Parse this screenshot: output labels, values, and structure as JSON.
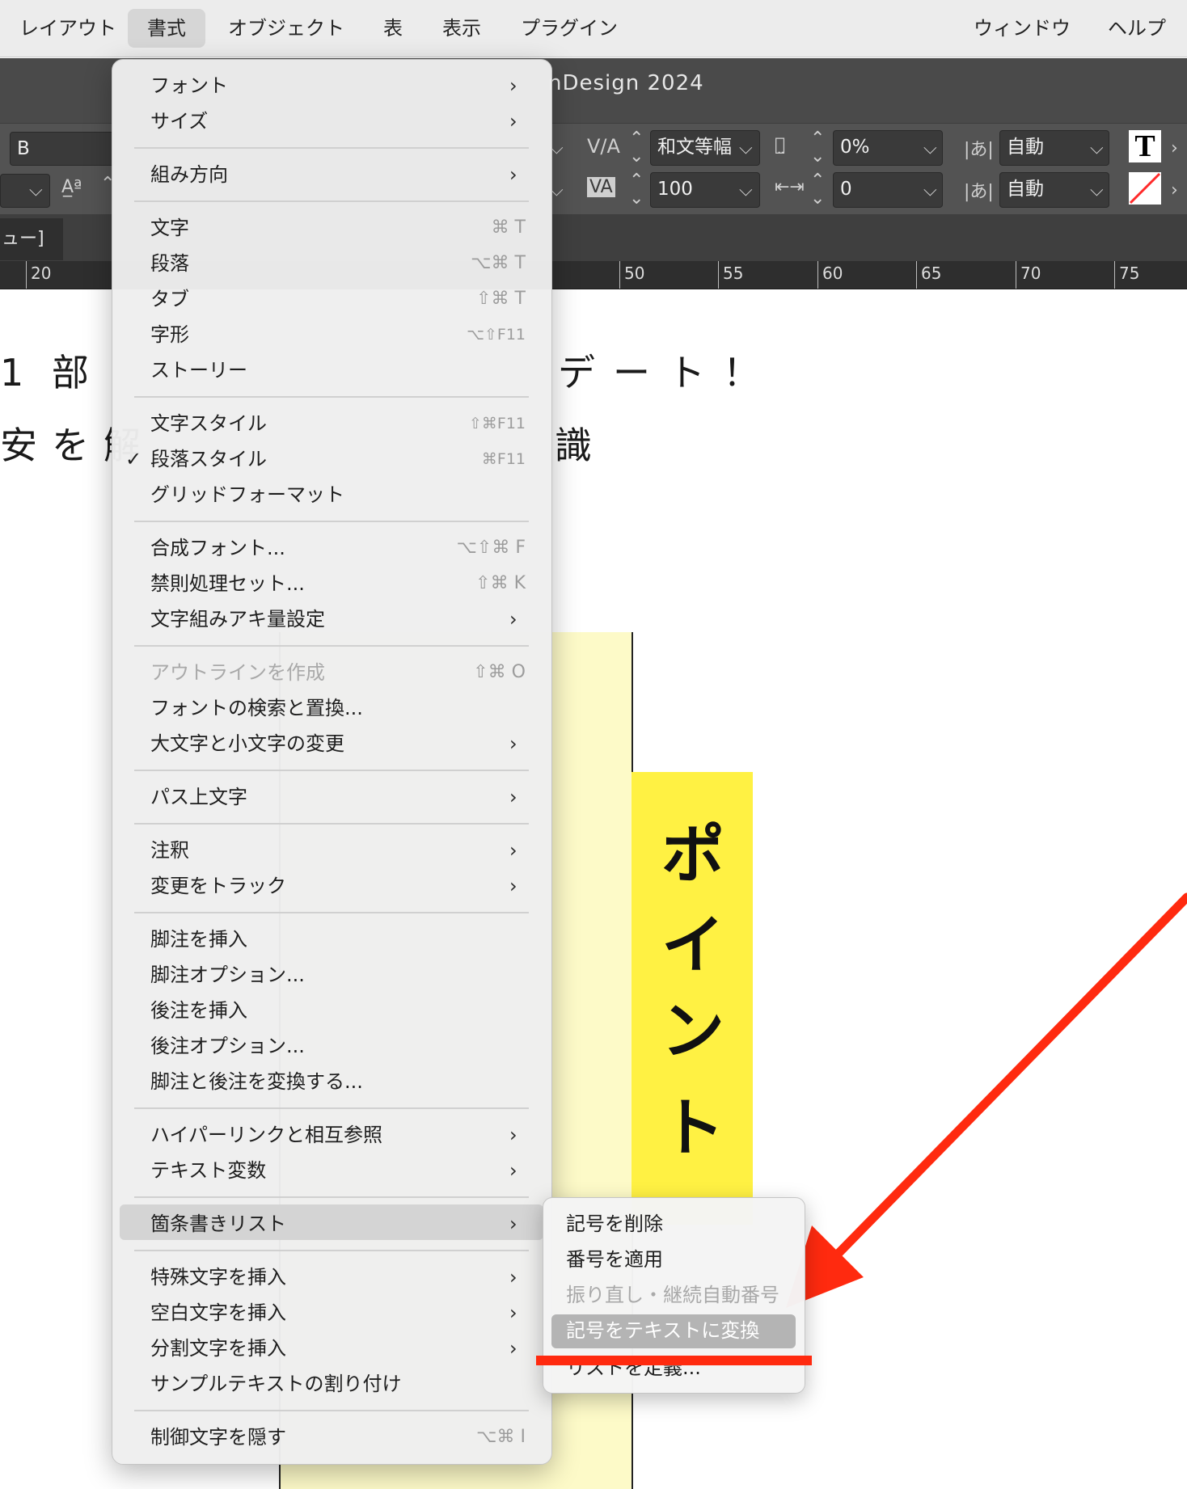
{
  "menubar": {
    "items": [
      "レイアウト",
      "書式",
      "オブジェクト",
      "表",
      "表示",
      "プラグイン",
      "ウィンドウ",
      "ヘルプ"
    ]
  },
  "window": {
    "title_partial": "nDesign 2024"
  },
  "control_bar": {
    "font_style": "B",
    "kerning_value": "和文等幅",
    "tracking_value": "0%",
    "vertical_scale_value": "100",
    "baseline_value": "0",
    "aki_before": "自動",
    "aki_after": "自動"
  },
  "doc_tab": {
    "label": "ュー]"
  },
  "ruler": {
    "labels": [
      "20",
      "50",
      "55",
      "60",
      "65",
      "70",
      "75"
    ]
  },
  "document": {
    "line1_left": "1 部",
    "line1_right": "デート！",
    "line2_left": "安を解",
    "line2_right": "識",
    "point_label": [
      "ポ",
      "イ",
      "ン",
      "ト"
    ]
  },
  "format_menu": {
    "items": [
      {
        "label": "フォント",
        "shortcut": "",
        "submenu": true,
        "disabled": false
      },
      {
        "label": "サイズ",
        "shortcut": "",
        "submenu": true,
        "disabled": false
      },
      {
        "label": "組み方向",
        "shortcut": "",
        "submenu": true,
        "disabled": false
      },
      {
        "label": "文字",
        "shortcut": "⌘ T",
        "submenu": false,
        "disabled": false
      },
      {
        "label": "段落",
        "shortcut": "⌥⌘ T",
        "submenu": false,
        "disabled": false
      },
      {
        "label": "タブ",
        "shortcut": "⇧⌘ T",
        "submenu": false,
        "disabled": false
      },
      {
        "label": "字形",
        "shortcut": "⌥⇧F11",
        "submenu": false,
        "disabled": false
      },
      {
        "label": "ストーリー",
        "shortcut": "",
        "submenu": false,
        "disabled": false
      },
      {
        "label": "文字スタイル",
        "shortcut": "⇧⌘F11",
        "submenu": false,
        "disabled": false
      },
      {
        "label": "段落スタイル",
        "shortcut": "⌘F11",
        "submenu": false,
        "disabled": false,
        "checked": true
      },
      {
        "label": "グリッドフォーマット",
        "shortcut": "",
        "submenu": false,
        "disabled": false
      },
      {
        "label": "合成フォント...",
        "shortcut": "⌥⇧⌘ F",
        "submenu": false,
        "disabled": false
      },
      {
        "label": "禁則処理セット...",
        "shortcut": "⇧⌘ K",
        "submenu": false,
        "disabled": false
      },
      {
        "label": "文字組みアキ量設定",
        "shortcut": "",
        "submenu": true,
        "disabled": false
      },
      {
        "label": "アウトラインを作成",
        "shortcut": "⇧⌘ O",
        "submenu": false,
        "disabled": true
      },
      {
        "label": "フォントの検索と置換...",
        "shortcut": "",
        "submenu": false,
        "disabled": false
      },
      {
        "label": "大文字と小文字の変更",
        "shortcut": "",
        "submenu": true,
        "disabled": false
      },
      {
        "label": "パス上文字",
        "shortcut": "",
        "submenu": true,
        "disabled": false
      },
      {
        "label": "注釈",
        "shortcut": "",
        "submenu": true,
        "disabled": false
      },
      {
        "label": "変更をトラック",
        "shortcut": "",
        "submenu": true,
        "disabled": false
      },
      {
        "label": "脚注を挿入",
        "shortcut": "",
        "submenu": false,
        "disabled": false
      },
      {
        "label": "脚注オプション...",
        "shortcut": "",
        "submenu": false,
        "disabled": false
      },
      {
        "label": "後注を挿入",
        "shortcut": "",
        "submenu": false,
        "disabled": false
      },
      {
        "label": "後注オプション...",
        "shortcut": "",
        "submenu": false,
        "disabled": false
      },
      {
        "label": "脚注と後注を変換する...",
        "shortcut": "",
        "submenu": false,
        "disabled": false
      },
      {
        "label": "ハイパーリンクと相互参照",
        "shortcut": "",
        "submenu": true,
        "disabled": false
      },
      {
        "label": "テキスト変数",
        "shortcut": "",
        "submenu": true,
        "disabled": false
      },
      {
        "label": "箇条書きリスト",
        "shortcut": "",
        "submenu": true,
        "disabled": false,
        "highlighted": true
      },
      {
        "label": "特殊文字を挿入",
        "shortcut": "",
        "submenu": true,
        "disabled": false
      },
      {
        "label": "空白文字を挿入",
        "shortcut": "",
        "submenu": true,
        "disabled": false
      },
      {
        "label": "分割文字を挿入",
        "shortcut": "",
        "submenu": true,
        "disabled": false
      },
      {
        "label": "サンプルテキストの割り付け",
        "shortcut": "",
        "submenu": false,
        "disabled": false
      },
      {
        "label": "制御文字を隠す",
        "shortcut": "⌥⌘ I",
        "submenu": false,
        "disabled": false
      }
    ]
  },
  "bullets_submenu": {
    "items": [
      {
        "label": "記号を削除",
        "disabled": false
      },
      {
        "label": "番号を適用",
        "disabled": false
      },
      {
        "label": "振り直し・継続自動番号",
        "disabled": true
      },
      {
        "label": "記号をテキストに変換",
        "disabled": false,
        "highlighted": true
      },
      {
        "label": "リストを定義...",
        "disabled": false
      }
    ]
  },
  "colors": {
    "highlight_stroke": "#ff2a0f",
    "point_box": "#fff143",
    "frame_fill": "#fdfac8"
  }
}
